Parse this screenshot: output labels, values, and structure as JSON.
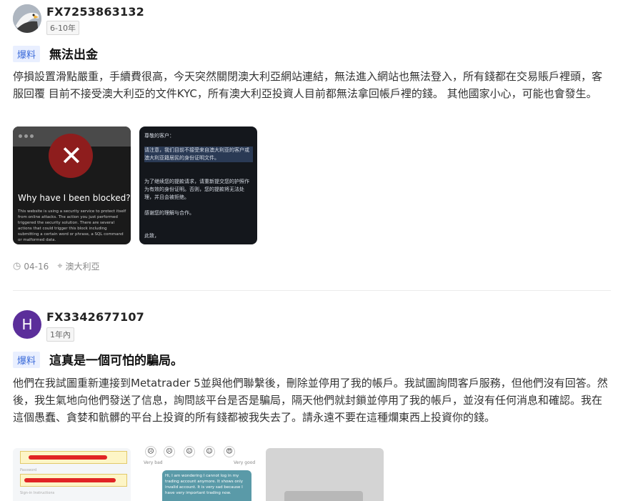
{
  "posts": [
    {
      "username": "FX7253863132",
      "tenure": "6-10年",
      "badge": "爆料",
      "title": "無法出金",
      "body": "停損設置滑點嚴重，手續費很高，今天突然關閉澳大利亞網站連結，無法進入網站也無法登入，所有錢都在交易賬戶裡頭，客服回覆 目前不接受澳大利亞的文件KYC，所有澳大利亞投資人目前都無法拿回帳戶裡的錢。 其他國家小心，可能也會發生。",
      "images": [
        {
          "heading": "Why have I been blocked?",
          "desc": "This website is using a security service to protect itself from online attacks. The action you just performed triggered the security solution. There are several actions that could trigger this block including submitting a certain word or phrase, a SQL command or malformed data."
        },
        {
          "lines": [
            "尊敬的客户：",
            "请注意，我们目前不接受来自澳大利亚的客户或澳大利亚籍居民的身份证明文件。",
            "为了继续您的提款请求，请重新提交您的护照作为有效的身份证明。否则，您的提款将无法处理，并且会被拒绝。",
            "感谢您的理解与合作。",
            "此致，"
          ]
        }
      ],
      "date": "04-16",
      "location": "澳大利亞"
    },
    {
      "avatar_letter": "H",
      "username": "FX3342677107",
      "tenure": "1年內",
      "badge": "爆料",
      "title": "這真是一個可怕的騙局。",
      "body": "他們在我試圖重新連接到Metatrader 5並與他們聯繫後，刪除並停用了我的帳戶。我試圖詢問客戶服務，但他們沒有回答。然後，我生氣地向他們發送了信息，詢問該平台是否是騙局，隔天他們就封鎖並停用了我的帳戶，並沒有任何消息和確認。我在這個愚蠢、貪婪和骯髒的平台上投資的所有錢都被我失去了。請永遠不要在這種爛東西上投資你的錢。",
      "images": [
        {
          "labels": [
            "Password",
            "Sign-in Instructions"
          ]
        },
        {
          "rating_low": "Very bad",
          "rating_high": "Very good",
          "chat": "Hi, I am wondering I cannot log in my trading account anymore. It shows only invalid account. It is very sad because I have very important trading now."
        },
        {}
      ]
    }
  ],
  "colors": {
    "badge_text": "#3b6bd9",
    "badge_bg": "#e9efff",
    "avatar2_bg": "#5b2e9a",
    "blocked_red": "#8e1d1d"
  },
  "icons": {
    "clock": "clock-icon",
    "location": "location-pin-icon",
    "eagle_avatar": "eagle-avatar-icon"
  }
}
